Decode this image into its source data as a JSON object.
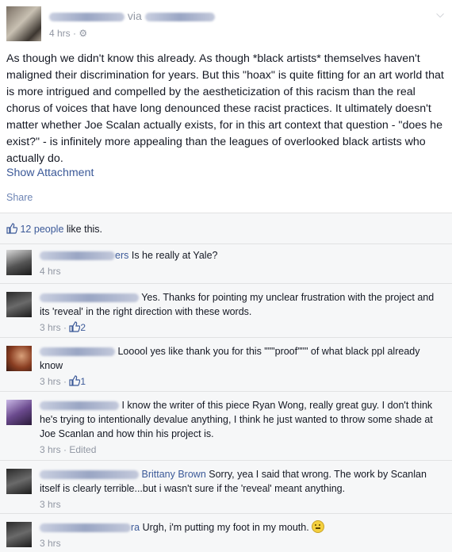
{
  "post": {
    "via_label": "via",
    "timestamp": "4 hrs",
    "text": "As though we didn't know this already. As though *black artists* themselves haven't maligned their discrimination for years. But this \"hoax\" is quite fitting for an art world that is more intrigued and compelled by the aestheticization of this racism than the real chorus of voices that have long denounced these racist practices. It ultimately doesn't matter whether Joe Scalan actually exists, for in this art context that question - \"does he exist?\" - is infinitely more appealing than the leagues of overlooked black artists who actually do.",
    "show_attachment": "Show Attachment",
    "share": "Share"
  },
  "likes": {
    "count_text": "12 people",
    "suffix": " like this."
  },
  "comments": [
    {
      "name_tail": "ers",
      "text": " Is he really at Yale?",
      "time": "4 hrs",
      "likes": ""
    },
    {
      "name_tail": "",
      "text": " Yes. Thanks for pointing my unclear frustration with the project and its 'reveal' in the right direction with these words.",
      "time": "3 hrs",
      "likes": "2"
    },
    {
      "name_tail": "",
      "text": " Looool yes like thank you for this \"\"\"proof\"\"\" of what black ppl already know",
      "time": "3 hrs",
      "likes": "1"
    },
    {
      "name_tail": "",
      "text": " I know the writer of this piece Ryan Wong, really great guy. I don't think he's trying to intentionally devalue anything, I think he just wanted to throw some shade at Joe Scanlan and how thin his project is.",
      "time": "3 hrs",
      "edited": "Edited"
    },
    {
      "name_tail": "",
      "mention": "Brittany Brown",
      "text": " Sorry, yea I said that wrong. The work by Scanlan itself is clearly terrible...but i wasn't sure if the 'reveal' meant anything.",
      "time": "3 hrs"
    },
    {
      "name_tail": "ra",
      "text": " Urgh, i'm putting my foot in my mouth. ",
      "time": "3 hrs"
    }
  ],
  "colors": {
    "link": "#3b5998",
    "meta": "#9197a3",
    "ufi_bg": "#f6f7f8"
  }
}
